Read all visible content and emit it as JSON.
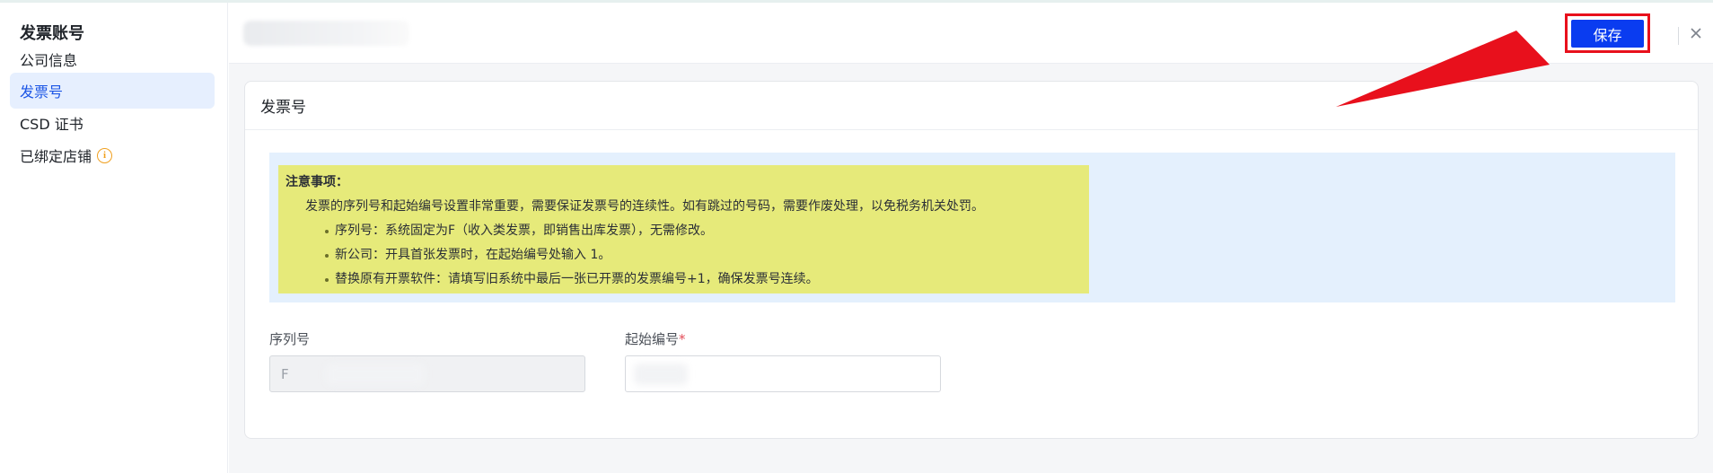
{
  "sidebar": {
    "title": "发票账号",
    "items": [
      {
        "label": "公司信息"
      },
      {
        "label": "发票号"
      },
      {
        "label": "CSD 证书"
      },
      {
        "label": "已绑定店铺"
      }
    ]
  },
  "header": {
    "save_label": "保存"
  },
  "card": {
    "title": "发票号",
    "notice": {
      "title": "注意事项：",
      "description": "发票的序列号和起始编号设置非常重要，需要保证发票号的连续性。如有跳过的号码，需要作废处理，以免税务机关处罚。",
      "items": [
        "序列号：系统固定为F（收入类发票，即销售出库发票），无需修改。",
        "新公司：开具首张发票时，在起始编号处输入 1。",
        "替换原有开票软件：请填写旧系统中最后一张已开票的发票编号+1，确保发票号连续。"
      ]
    },
    "fields": {
      "serial": {
        "label": "序列号",
        "value": "F"
      },
      "start_number": {
        "label": "起始编号",
        "required_mark": "*",
        "value": ""
      }
    }
  },
  "colors": {
    "primary": "#0a3cf0",
    "active_nav_bg": "#e6effe",
    "active_nav_text": "#1b55e5",
    "notice_bg": "#e4f0fd",
    "highlight": "#e6ea7a",
    "annotation_red": "#e8101c"
  },
  "icons": {
    "close": "close-icon",
    "info": "info-icon"
  }
}
